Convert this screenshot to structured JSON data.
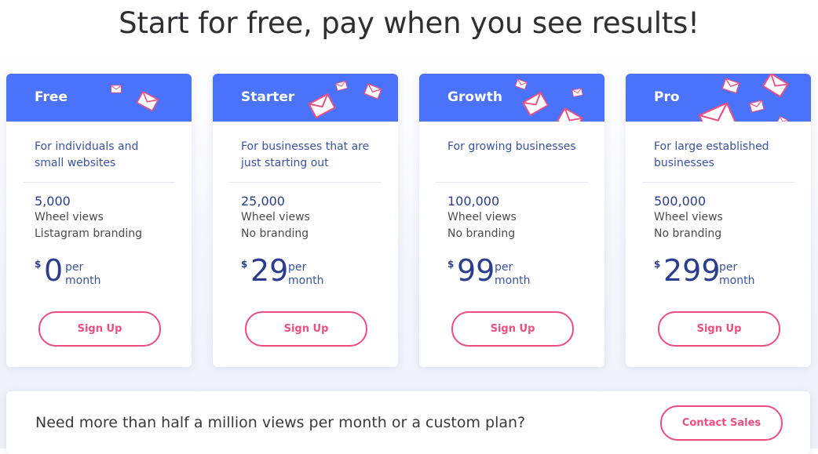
{
  "headline": "Start for free, pay when you see results!",
  "colors": {
    "header_blue": "#4a73fa",
    "accent_pink": "#ef4d7f",
    "text_navy": "#2b3d8f"
  },
  "plans": [
    {
      "name": "Free",
      "description": "For individuals and small websites",
      "views": "5,000",
      "views_label": "Wheel views",
      "branding": "Listagram branding",
      "currency": "$",
      "price": "0",
      "per": "per",
      "period": "month",
      "cta": "Sign Up"
    },
    {
      "name": "Starter",
      "description": "For businesses that are just starting out",
      "views": "25,000",
      "views_label": "Wheel views",
      "branding": "No branding",
      "currency": "$",
      "price": "29",
      "per": "per",
      "period": "month",
      "cta": "Sign Up"
    },
    {
      "name": "Growth",
      "description": "For growing businesses",
      "views": "100,000",
      "views_label": "Wheel views",
      "branding": "No branding",
      "currency": "$",
      "price": "99",
      "per": "per",
      "period": "month",
      "cta": "Sign Up"
    },
    {
      "name": "Pro",
      "description": "For large established businesses",
      "views": "500,000",
      "views_label": "Wheel views",
      "branding": "No branding",
      "currency": "$",
      "price": "299",
      "per": "per",
      "period": "month",
      "cta": "Sign Up"
    }
  ],
  "banner": {
    "text": "Need more than half a million views per month or a custom plan?",
    "cta": "Contact Sales"
  },
  "icons": {
    "decoration": "envelope-icon"
  }
}
